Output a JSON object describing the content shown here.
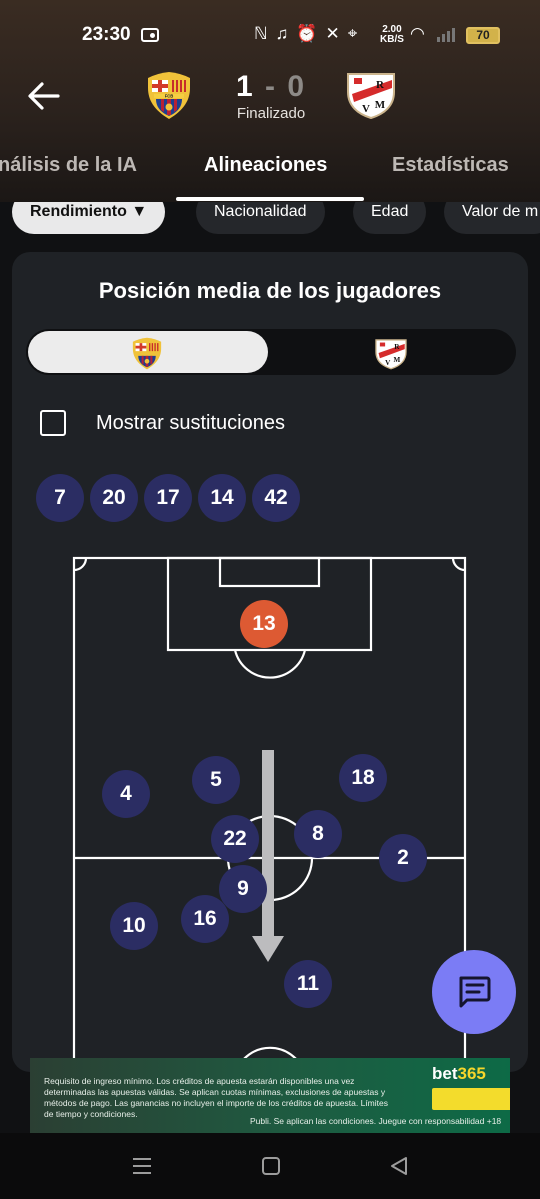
{
  "status_bar": {
    "time": "23:30",
    "speed_value": "2.00",
    "speed_unit": "KB/S",
    "battery": "70",
    "icons": [
      "radio-icon",
      "nfc-icon",
      "headphones-icon",
      "alarm-icon",
      "mute-icon",
      "location-icon",
      "wifi-icon",
      "signal-icon",
      "battery-icon"
    ]
  },
  "match": {
    "home_score": "1",
    "separator": "-",
    "away_score": "0",
    "status": "Finalizado",
    "home_team_crest": "barcelona-crest",
    "away_team_crest": "rayo-vallecano-crest"
  },
  "tabs": [
    "nálisis de la IA",
    "Alineaciones",
    "Estadísticas"
  ],
  "active_tab": "Alineaciones",
  "chips": {
    "active_label": "Rendimiento",
    "active_arrow": "▼",
    "others": [
      "Nacionalidad",
      "Edad",
      "Valor de m"
    ]
  },
  "card": {
    "title": "Posición media de los jugadores",
    "team_toggle": {
      "selected": "barcelona-crest",
      "other": "rayo-vallecano-crest"
    },
    "show_subs_label": "Mostrar sustituciones",
    "show_subs_checked": false,
    "substitutes": [
      "7",
      "20",
      "17",
      "14",
      "42"
    ]
  },
  "pitch_players": [
    {
      "number": "13",
      "role": "gk"
    },
    {
      "number": "4"
    },
    {
      "number": "5"
    },
    {
      "number": "18"
    },
    {
      "number": "22"
    },
    {
      "number": "8"
    },
    {
      "number": "2"
    },
    {
      "number": "9"
    },
    {
      "number": "16"
    },
    {
      "number": "10"
    },
    {
      "number": "11"
    }
  ],
  "colors": {
    "player_badge": "#2b2d63",
    "goalkeeper_badge": "#dd5a33",
    "fab": "#7b7cf5",
    "card_bg": "#1f2226"
  },
  "ad": {
    "text": "Requisito de ingreso mínimo. Los créditos de apuesta estarán disponibles una vez determinadas las apuestas válidas. Se aplican cuotas mínimas, exclusiones de apuestas y métodos de pago. Las ganancias no incluyen el importe de los créditos de apuesta. Límites de tiempo y condiciones.",
    "footer": "Publi. Se aplican las condiciones. Juegue con responsabilidad +18",
    "brand_main": "bet",
    "brand_num": "365"
  },
  "fab_icon": "chat-icon",
  "nav": [
    "menu-icon",
    "home-icon",
    "back-icon"
  ]
}
